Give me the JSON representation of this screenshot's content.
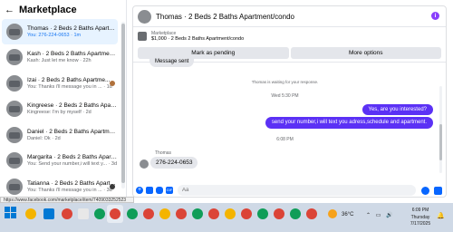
{
  "sidebar": {
    "title": "Marketplace",
    "conversations": [
      {
        "name": "Thomas · 2 Beds 2 Baths Apartment/condo",
        "preview": "You: 276-224-0653 · 1m",
        "active": true
      },
      {
        "name": "Kash · 2 Beds 2 Baths Apartment/condo",
        "preview": "Kash: Just let me know · 22h"
      },
      {
        "name": "Izai · 2 Beds 2 Baths Apartme...",
        "preview": "You: Thanks i'll message you in ... · 1d"
      },
      {
        "name": "Kingreese · 2 Beds 2 Baths Apartment/condo",
        "preview": "Kingreese: I'm by myself · 2d"
      },
      {
        "name": "Daniel · 2 Beds 2 Baths Apartment/condo",
        "preview": "Daniel: Ok · 2d"
      },
      {
        "name": "Margarita · 2 Beds 2 Baths Apartme...",
        "preview": "You: Send your number,i will text y... · 3d"
      },
      {
        "name": "Tatianna · 2 Beds 2 Baths Apartm...",
        "preview": "You: Thanks i'll message you in ... · 3d"
      }
    ]
  },
  "chat": {
    "title": "Thomas · 2 Beds 2 Baths Apartment/condo",
    "info_icon": "i",
    "listing_label": "Marketplace",
    "listing_detail": "$1,000 · 2 Beds 2 Baths Apartment/condo",
    "mark_pending": "Mark as pending",
    "more_options": "More options",
    "messages": {
      "prev_message": "Message sent",
      "system_note": "Thomas is waiting for your response.",
      "time1": "Wed 5:30 PM",
      "out1": "Yes, are you interested?",
      "out2": "send your number,i will text you adress,schedule and apartment.",
      "time2": "6:08 PM",
      "sender": "Thomas",
      "in1": "276-224-0653"
    },
    "input_placeholder": "Aa"
  },
  "status_url": "https://www.facebook.com/marketplace/item/7409033252523",
  "taskbar": {
    "temperature": "36°C",
    "time": "6:09 PM",
    "day": "Thursday",
    "date": "7/17/2025"
  }
}
